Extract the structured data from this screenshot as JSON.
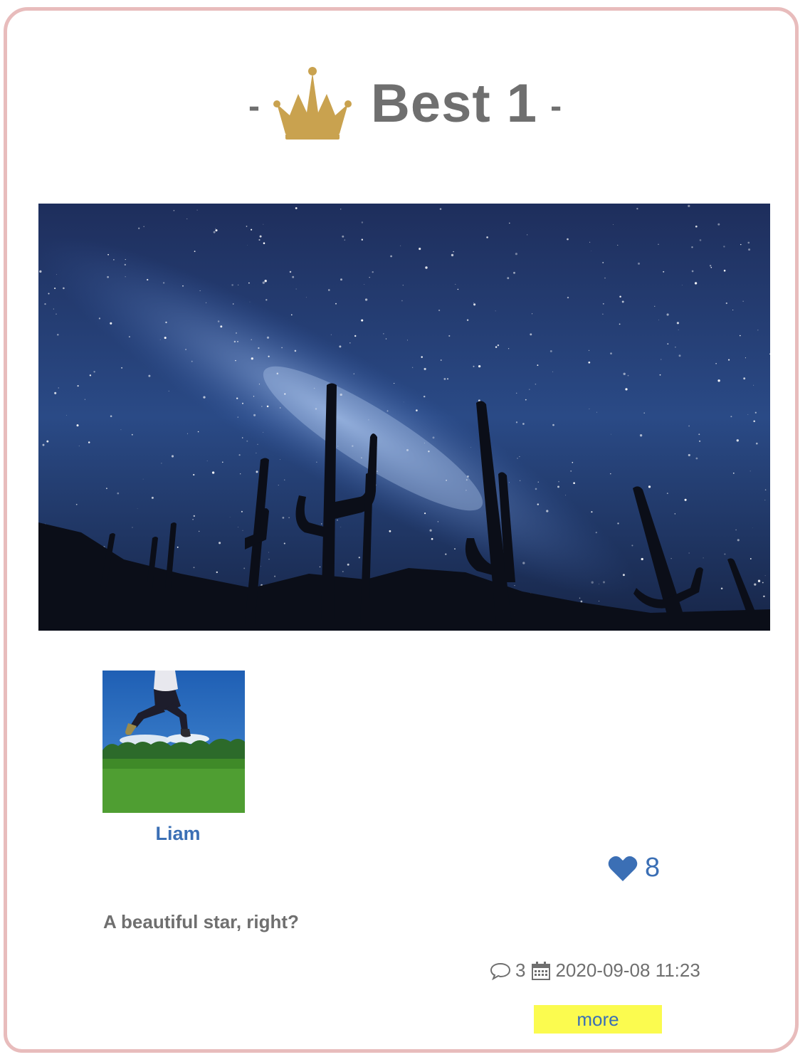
{
  "post": {
    "rank_title": "Best 1",
    "dash_left": "-",
    "dash_right": "-",
    "author": "Liam",
    "likes": "8",
    "caption": "A beautiful star, right?",
    "comments": "3",
    "date": "2020-09-08 11:23",
    "more_label": "more"
  },
  "icons": {
    "crown": "crown-icon",
    "heart": "heart-icon",
    "comment": "comment-icon",
    "calendar": "calendar-icon"
  },
  "colors": {
    "border": "#e8bcbc",
    "gold": "#c9a24f",
    "text_gray": "#6f6f6f",
    "link_blue": "#3b6fb5",
    "more_bg": "#fbfb4f"
  }
}
